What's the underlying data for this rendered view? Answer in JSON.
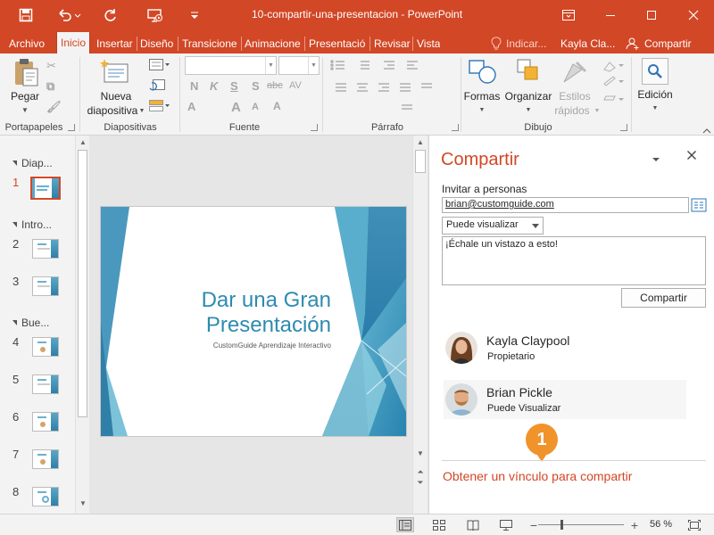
{
  "titlebar": {
    "title": "10-compartir-una-presentacion  -  PowerPoint",
    "icons": [
      "save-icon",
      "undo-icon",
      "redo-icon",
      "start-slideshow-icon",
      "customize-dropdown-icon",
      "ribbon-display-icon",
      "minimize-icon",
      "maximize-icon",
      "close-icon"
    ],
    "bg": "#d24726"
  },
  "tabs": {
    "archivo": "Archivo",
    "inicio": "Inicio",
    "insertar": "Insertar",
    "diseno": "Diseño",
    "transiciones": "Transicione",
    "animaciones": "Animacione",
    "presentacion": "Presentació",
    "revisar": "Revisar",
    "vista": "Vista",
    "tell_me": "Indicar...",
    "user": "Kayla Cla...",
    "share": "Compartir"
  },
  "ribbon": {
    "paste": "Pegar",
    "new_slide_line1": "Nueva",
    "new_slide_line2": "diapositiva",
    "format_buttons": [
      "N",
      "K",
      "S",
      "S",
      "abc",
      "AV"
    ],
    "shapes": "Formas",
    "arrange": "Organizar",
    "styles_line1": "Estilos",
    "styles_line2": "rápidos",
    "editing": "Edición",
    "groups": {
      "clipboard": "Portapapeles",
      "slides": "Diapositivas",
      "font": "Fuente",
      "paragraph": "Párrafo",
      "drawing": "Dibujo"
    }
  },
  "slides_pane": {
    "sections": [
      "Diap...",
      "Intro...",
      "Bue..."
    ],
    "slide_numbers": [
      "1",
      "2",
      "3",
      "4",
      "5",
      "6",
      "7",
      "8"
    ],
    "current": "1"
  },
  "slide": {
    "title_line1": "Dar una Gran",
    "title_line2": "Presentación",
    "subtitle": "CustomGuide Aprendizaje Interactivo"
  },
  "share_pane": {
    "title": "Compartir",
    "invite_label": "Invitar a personas",
    "invite_value": "brian@customguide.com",
    "permission": "Puede visualizar",
    "message": "¡Échale un vistazo a esto!",
    "share_button": "Compartir",
    "people": [
      {
        "name": "Kayla Claypool",
        "role": "Propietario"
      },
      {
        "name": "Brian Pickle",
        "role": "Puede Visualizar"
      }
    ],
    "get_link": "Obtener un vínculo para compartir",
    "callout_number": "1",
    "accent": "#d24726",
    "callout_color": "#f0932b"
  },
  "statusbar": {
    "zoom": "56 %"
  }
}
